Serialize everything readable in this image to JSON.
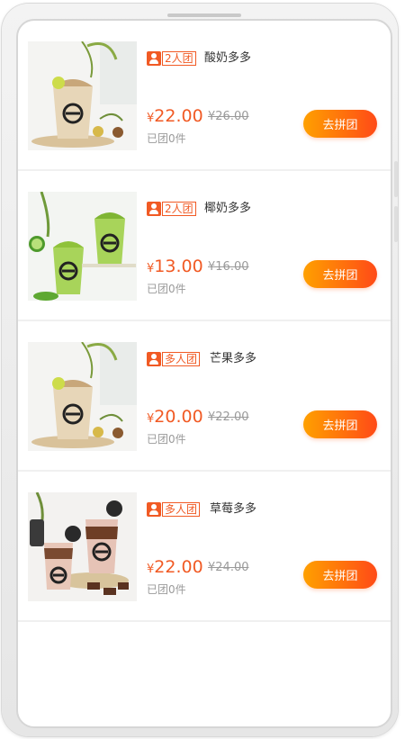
{
  "products": [
    {
      "tag": "2人团",
      "title": "酸奶多多",
      "currency": "¥",
      "price": "22.00",
      "original_price": "¥26.00",
      "sold": "已团0件",
      "button": "去拼团",
      "image": "yogurt-drink"
    },
    {
      "tag": "2人团",
      "title": "椰奶多多",
      "currency": "¥",
      "price": "13.00",
      "original_price": "¥16.00",
      "sold": "已团0件",
      "button": "去拼团",
      "image": "coconut-green-drink"
    },
    {
      "tag": "多人团",
      "title": "芒果多多",
      "currency": "¥",
      "price": "20.00",
      "original_price": "¥22.00",
      "sold": "已团0件",
      "button": "去拼团",
      "image": "mango-drink"
    },
    {
      "tag": "多人团",
      "title": "草莓多多",
      "currency": "¥",
      "price": "22.00",
      "original_price": "¥24.00",
      "sold": "已团0件",
      "button": "去拼团",
      "image": "strawberry-oreo-drink"
    }
  ],
  "colors": {
    "accent": "#f15a24",
    "button_start": "#ffa000",
    "button_end": "#ff4a17",
    "muted": "#9a9a9a"
  }
}
